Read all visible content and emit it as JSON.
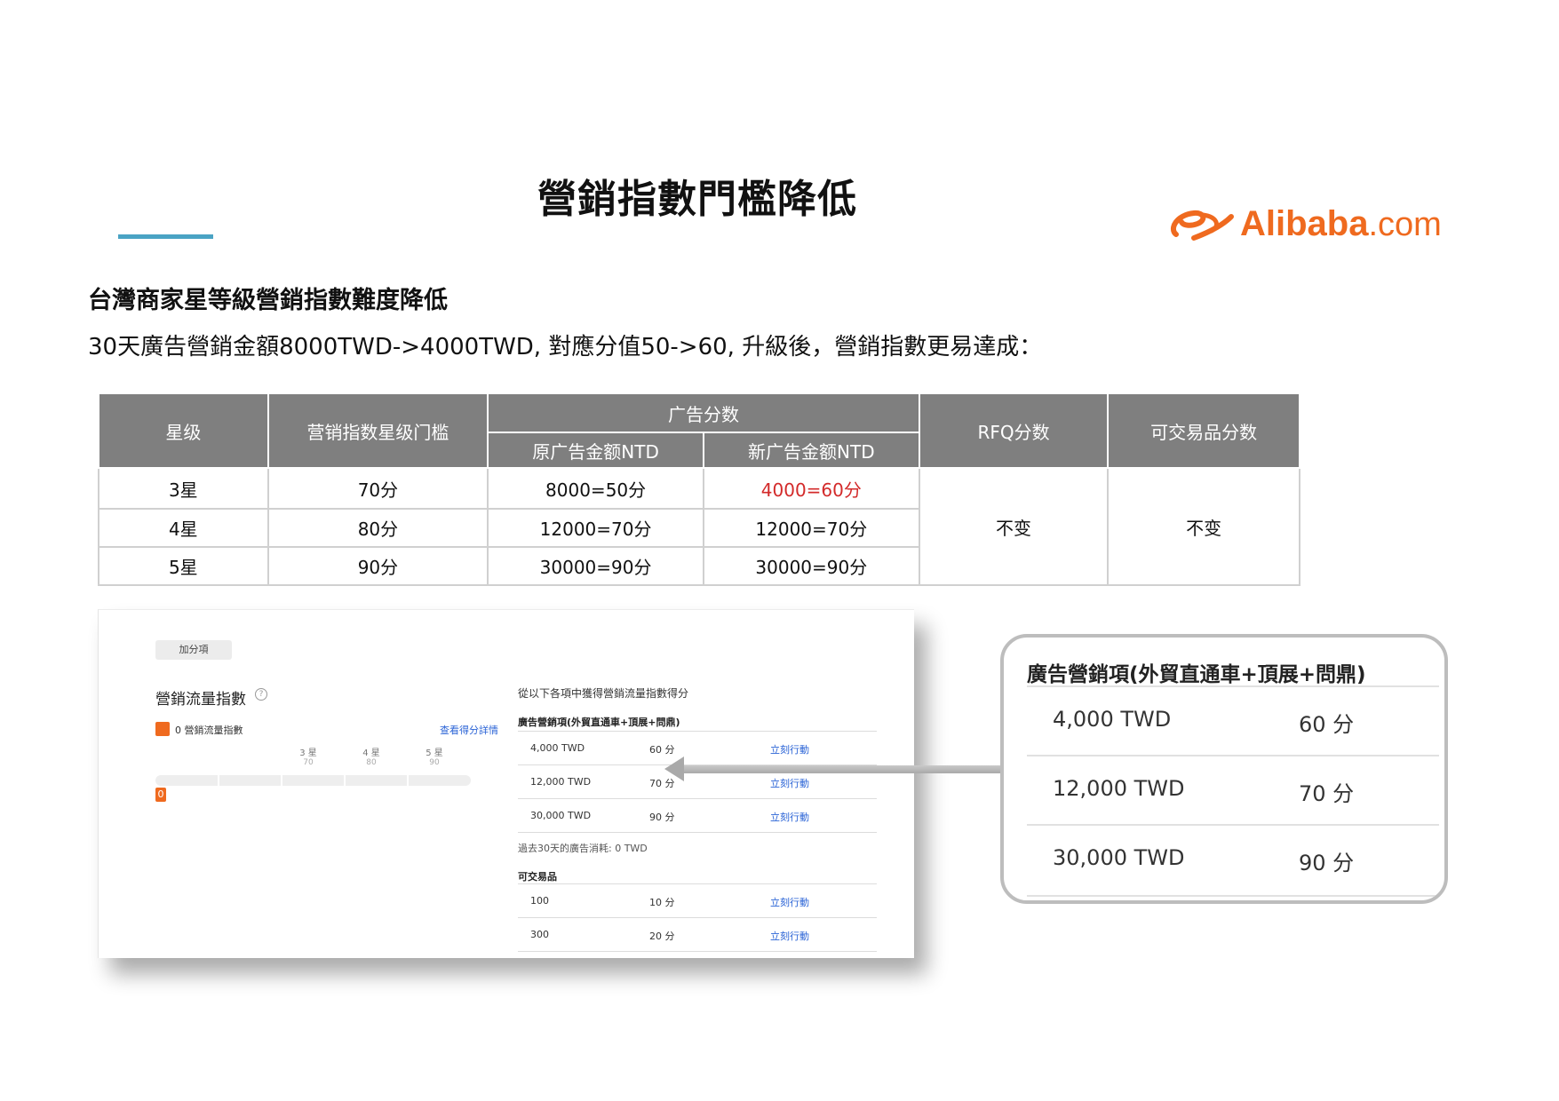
{
  "title": "營銷指數門檻降低",
  "logo": {
    "brand": "Alibaba",
    "suffix": ".com",
    "color": "#ef6a1f"
  },
  "subheading": "台灣商家星等級營銷指數難度降低",
  "description": "30天廣告營銷金額8000TWD->4000TWD, 對應分值50->60, 升級後，營銷指數更易達成：",
  "table": {
    "headers": {
      "star": "星级",
      "threshold": "营销指数星级门槛",
      "ad_score": "广告分数",
      "old_amount": "原广告金额NTD",
      "new_amount": "新广告金额NTD",
      "rfq": "RFQ分数",
      "tradable": "可交易品分数"
    },
    "rows": [
      {
        "star": "3星",
        "threshold": "70分",
        "old": "8000=50分",
        "new": "4000=60分"
      },
      {
        "star": "4星",
        "threshold": "80分",
        "old": "12000=70分",
        "new": "12000=70分"
      },
      {
        "star": "5星",
        "threshold": "90分",
        "old": "30000=90分",
        "new": "30000=90分"
      }
    ],
    "rfq_value": "不变",
    "tradable_value": "不变",
    "highlight_color": "#d32a2a"
  },
  "screenshot": {
    "tag": "加分項",
    "index_title": "營銷流量指數",
    "index_value": "0 營銷流量指數",
    "detail_link": "查看得分詳情",
    "ticks": [
      {
        "label": "3 星",
        "value": "70"
      },
      {
        "label": "4 星",
        "value": "80"
      },
      {
        "label": "5 星",
        "value": "90"
      }
    ],
    "marker": "0",
    "intro": "從以下各項中獲得營銷流量指數得分",
    "ad_section": "廣告營銷項(外貿直通車+頂展+問鼎)",
    "ad_rows": [
      {
        "amount": "4,000 TWD",
        "score": "60 分",
        "action": "立刻行動"
      },
      {
        "amount": "12,000 TWD",
        "score": "70 分",
        "action": "立刻行動"
      },
      {
        "amount": "30,000 TWD",
        "score": "90 分",
        "action": "立刻行動"
      }
    ],
    "spend_note": "過去30天的廣告消耗: 0 TWD",
    "tradable_section": "可交易品",
    "tradable_rows": [
      {
        "amount": "100",
        "score": "10 分",
        "action": "立刻行動"
      },
      {
        "amount": "300",
        "score": "20 分",
        "action": "立刻行動"
      }
    ]
  },
  "magnified": {
    "title": "廣告營銷項(外貿直通車+頂展+問鼎)",
    "rows": [
      {
        "amount": "4,000 TWD",
        "score": "60 分"
      },
      {
        "amount": "12,000 TWD",
        "score": "70 分"
      },
      {
        "amount": "30,000 TWD",
        "score": "90 分"
      }
    ]
  }
}
